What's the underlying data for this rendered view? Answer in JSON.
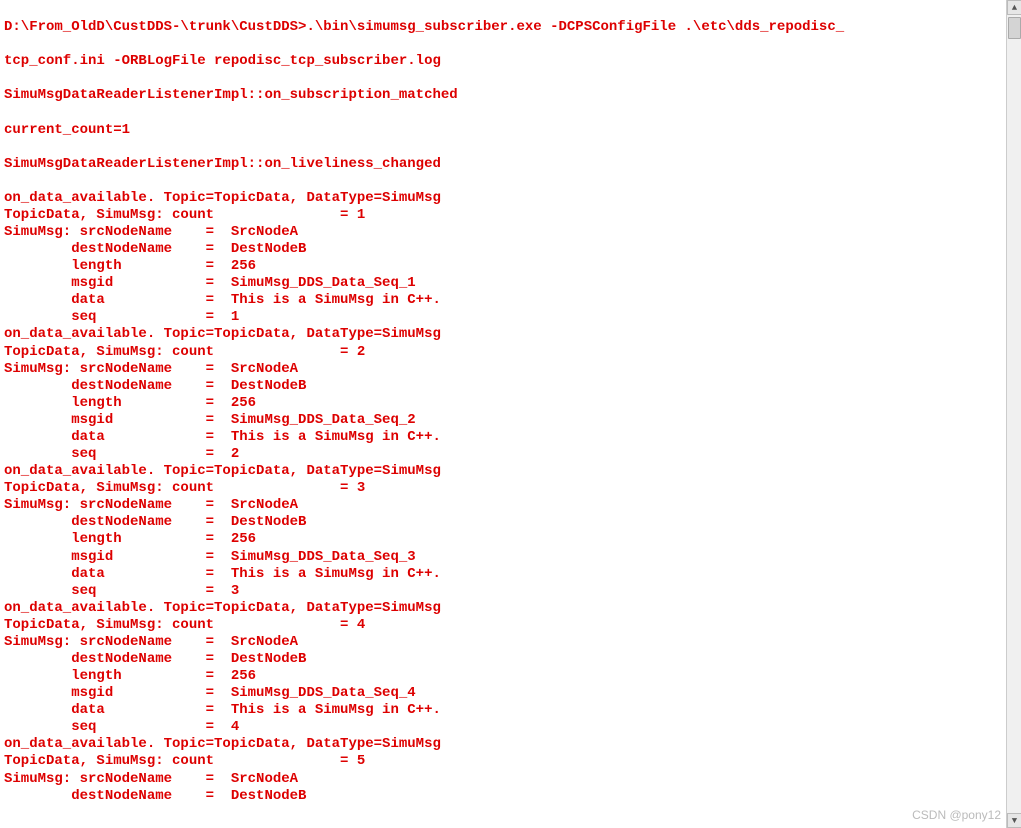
{
  "text_color": "#dd0000",
  "prompt": "D:\\From_OldD\\CustDDS-\\trunk\\CustDDS>",
  "command": ".\\bin\\simumsg_subscriber.exe -DCPSConfigFile .\\etc\\dds_repodisc_tcp_conf.ini -ORBLogFile repodisc_tcp_subscriber.log",
  "listener_matched": "SimuMsgDataReaderListenerImpl::on_subscription_matched",
  "current_count": "current_count=1",
  "listener_liveliness": "SimuMsgDataReaderListenerImpl::on_liveliness_changed",
  "on_data_prefix": "on_data_available. Topic=TopicData, DataType=SimuMsg",
  "count_prefix": "TopicData, SimuMsg: count               = ",
  "blocks": [
    {
      "count": "1",
      "src": "SrcNodeA",
      "dest": "DestNodeB",
      "length": "256",
      "msgid": "SimuMsg_DDS_Data_Seq_1",
      "data": "This is a SimuMsg in C++.",
      "seq": "1"
    },
    {
      "count": "2",
      "src": "SrcNodeA",
      "dest": "DestNodeB",
      "length": "256",
      "msgid": "SimuMsg_DDS_Data_Seq_2",
      "data": "This is a SimuMsg in C++.",
      "seq": "2"
    },
    {
      "count": "3",
      "src": "SrcNodeA",
      "dest": "DestNodeB",
      "length": "256",
      "msgid": "SimuMsg_DDS_Data_Seq_3",
      "data": "This is a SimuMsg in C++.",
      "seq": "3"
    },
    {
      "count": "4",
      "src": "SrcNodeA",
      "dest": "DestNodeB",
      "length": "256",
      "msgid": "SimuMsg_DDS_Data_Seq_4",
      "data": "This is a SimuMsg in C++.",
      "seq": "4"
    }
  ],
  "tail": {
    "count": "5",
    "src": "SrcNodeA",
    "dest": "DestNodeB"
  },
  "labels": {
    "src": "SimuMsg: srcNodeName    =  ",
    "dest": "        destNodeName    =  ",
    "length": "        length          =  ",
    "msgid": "        msgid           =  ",
    "data": "        data            =  ",
    "seq": "        seq             =  "
  },
  "watermark": "CSDN @pony12"
}
